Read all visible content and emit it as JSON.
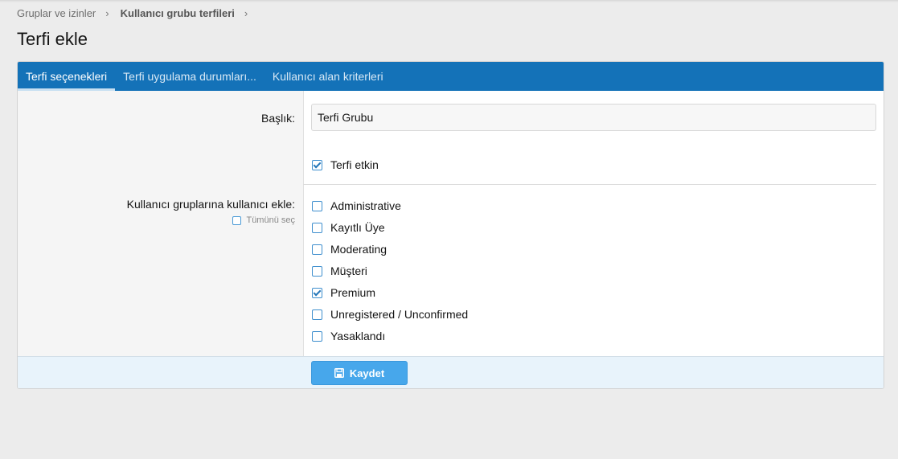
{
  "breadcrumb": {
    "items": [
      "Gruplar ve izinler",
      "Kullanıcı grubu terfileri"
    ],
    "separator": "›"
  },
  "page": {
    "title": "Terfi ekle"
  },
  "tabs": [
    {
      "label": "Terfi seçenekleri",
      "active": true
    },
    {
      "label": "Terfi uygulama durumları...",
      "active": false
    },
    {
      "label": "Kullanıcı alan kriterleri",
      "active": false
    }
  ],
  "form": {
    "title_label": "Başlık:",
    "title_value": "Terfi Grubu",
    "enabled_label": "Terfi etkin",
    "enabled_checked": true,
    "groups_label": "Kullanıcı gruplarına kullanıcı ekle:",
    "select_all_label": "Tümünü seç",
    "groups": [
      {
        "label": "Administrative",
        "checked": false
      },
      {
        "label": "Kayıtlı Üye",
        "checked": false
      },
      {
        "label": "Moderating",
        "checked": false
      },
      {
        "label": "Müşteri",
        "checked": false
      },
      {
        "label": "Premium",
        "checked": true
      },
      {
        "label": "Unregistered / Unconfirmed",
        "checked": false
      },
      {
        "label": "Yasaklandı",
        "checked": false
      }
    ],
    "save_label": "Kaydet"
  },
  "colors": {
    "accent": "#1472b8",
    "button": "#47a7eb",
    "footer": "#e8f3fb"
  }
}
